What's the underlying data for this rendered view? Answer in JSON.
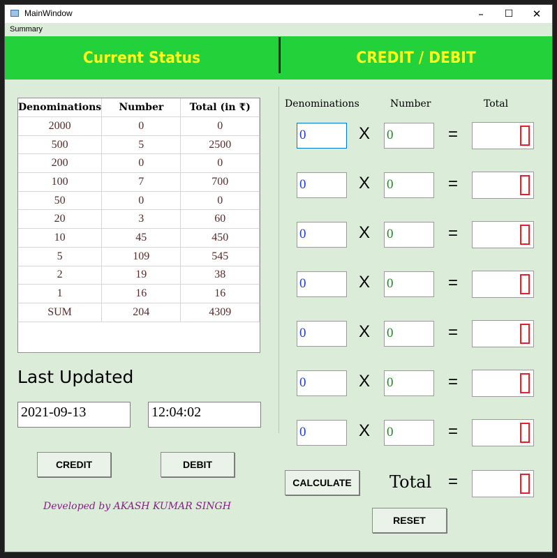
{
  "window": {
    "title": "MainWindow",
    "minimize": "–",
    "maximize": "☐",
    "close": "✕"
  },
  "menu": {
    "summary": "Summary"
  },
  "banners": {
    "left": "Current Status",
    "right": "CREDIT / DEBIT"
  },
  "table": {
    "headers": [
      "Denominations",
      "Number",
      "Total (in ₹)"
    ],
    "rows": [
      [
        "2000",
        "0",
        "0"
      ],
      [
        "500",
        "5",
        "2500"
      ],
      [
        "200",
        "0",
        "0"
      ],
      [
        "100",
        "7",
        "700"
      ],
      [
        "50",
        "0",
        "0"
      ],
      [
        "20",
        "3",
        "60"
      ],
      [
        "10",
        "45",
        "450"
      ],
      [
        "5",
        "109",
        "545"
      ],
      [
        "2",
        "19",
        "38"
      ],
      [
        "1",
        "16",
        "16"
      ],
      [
        "SUM",
        "204",
        "4309"
      ]
    ]
  },
  "last_updated": {
    "label": "Last Updated",
    "date": "2021-09-13",
    "time": "12:04:02"
  },
  "buttons": {
    "credit": "CREDIT",
    "debit": "DEBIT",
    "calculate": "CALCULATE",
    "reset": "RESET"
  },
  "developer": "Developed by AKASH KUMAR SINGH",
  "calc": {
    "headers": {
      "denominations": "Denominations",
      "number": "Number",
      "total": "Total"
    },
    "times": "X",
    "equals": "=",
    "rows": [
      {
        "denom": "0",
        "number": "0",
        "total": "0"
      },
      {
        "denom": "0",
        "number": "0",
        "total": "0"
      },
      {
        "denom": "0",
        "number": "0",
        "total": "0"
      },
      {
        "denom": "0",
        "number": "0",
        "total": "0"
      },
      {
        "denom": "0",
        "number": "0",
        "total": "0"
      },
      {
        "denom": "0",
        "number": "0",
        "total": "0"
      },
      {
        "denom": "0",
        "number": "0",
        "total": "0"
      }
    ],
    "grand_total_label": "Total",
    "grand_total": "0"
  },
  "colors": {
    "banner": "#23d13b",
    "banner_text": "#ffff1a",
    "background": "#dbedd9",
    "lcd_digit": "#e8202a",
    "credit_text": "#8b1a8b"
  }
}
